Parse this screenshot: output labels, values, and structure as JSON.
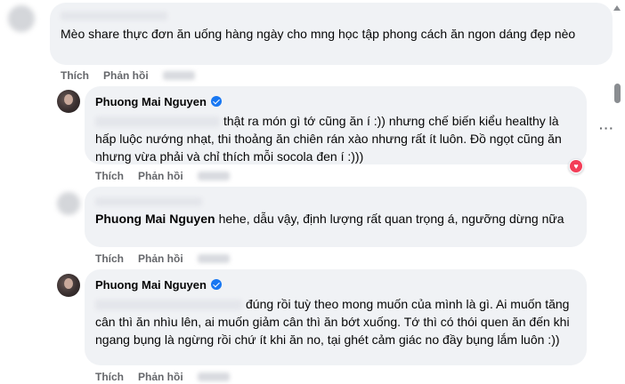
{
  "comments": [
    {
      "author": "",
      "text": "Mèo share thực đơn ăn uống hàng ngày cho mng học tập phong cách ăn ngon dáng đẹp nèo",
      "actions": {
        "like": "Thích",
        "reply": "Phản hồi"
      }
    },
    {
      "author": "Phuong Mai Nguyen",
      "verified": true,
      "text": "thật ra món gì tớ cũng ăn í :)) nhưng chế biến kiểu healthy là hấp luộc nướng nhạt, thi thoảng ăn chiên rán xào nhưng rất ít luôn. Đồ ngọt cũng ăn nhưng vừa phải và chỉ thích mỗi socola đen í :)))",
      "actions": {
        "like": "Thích",
        "reply": "Phản hồi"
      },
      "reaction": "heart-icon"
    },
    {
      "author": "",
      "tag": "Phuong Mai Nguyen",
      "text": "hehe, dẫu vậy, định lượng rất quan trọng á, ngưỡng dừng nữa",
      "actions": {
        "like": "Thích",
        "reply": "Phản hồi"
      }
    },
    {
      "author": "Phuong Mai Nguyen",
      "verified": true,
      "text": "đúng rồi tuỳ theo mong muốn của mình là gì. Ai muốn tăng cân thì ăn nhìu lên, ai muốn giảm cân thì ăn bớt xuống. Tớ thì có thói quen ăn đến khi ngang bụng là ngừng rồi chứ ít khi ăn no, tại ghét cảm giác no đầy bụng lắm luôn :))",
      "actions": {
        "like": "Thích",
        "reply": "Phản hồi"
      }
    }
  ],
  "more_options": "···",
  "colors": {
    "bubble": "#f0f2f5",
    "verified": "#1877f2",
    "heart": "#f33e58",
    "meta": "#65676b"
  }
}
